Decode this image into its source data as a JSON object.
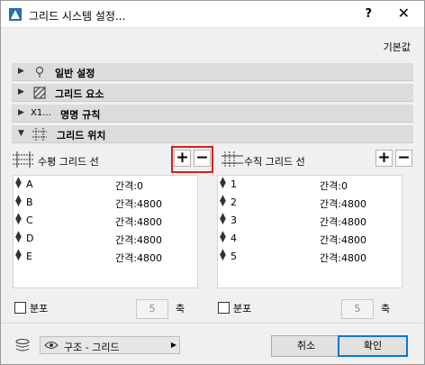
{
  "titlebar": {
    "title": "그리드 시스템 설정...",
    "help": "?",
    "close": "✕"
  },
  "defaults_link": "기본값",
  "sections": [
    {
      "label": "일반 설정",
      "icon": "pin-icon",
      "expanded": false
    },
    {
      "label": "그리드 요소",
      "icon": "grid-element-icon",
      "expanded": false
    },
    {
      "label": "명명 규칙",
      "icon": "naming-icon",
      "icon_text": "X1...",
      "expanded": false
    },
    {
      "label": "그리드 위치",
      "icon": "grid-position-icon",
      "expanded": true
    }
  ],
  "horizontal": {
    "label": "수평 그리드 선",
    "rows": [
      {
        "name": "A",
        "spacing": "간격:0"
      },
      {
        "name": "B",
        "spacing": "간격:4800"
      },
      {
        "name": "C",
        "spacing": "간격:4800"
      },
      {
        "name": "D",
        "spacing": "간격:4800"
      },
      {
        "name": "E",
        "spacing": "간격:4800"
      }
    ],
    "distribute_label": "분포",
    "count": "5",
    "axis_label": "축"
  },
  "vertical": {
    "label": "수직 그리드 선",
    "rows": [
      {
        "name": "1",
        "spacing": "간격:0"
      },
      {
        "name": "2",
        "spacing": "간격:4800"
      },
      {
        "name": "3",
        "spacing": "간격:4800"
      },
      {
        "name": "4",
        "spacing": "간격:4800"
      },
      {
        "name": "5",
        "spacing": "간격:4800"
      }
    ],
    "distribute_label": "분포",
    "count": "5",
    "axis_label": "축"
  },
  "buttons": {
    "add": "+",
    "remove": "−",
    "cancel": "취소",
    "ok": "확인"
  },
  "layer": {
    "label": "구조 - 그리드"
  },
  "colors": {
    "highlight": "#e01b1b",
    "primary_border": "#0078d7"
  }
}
